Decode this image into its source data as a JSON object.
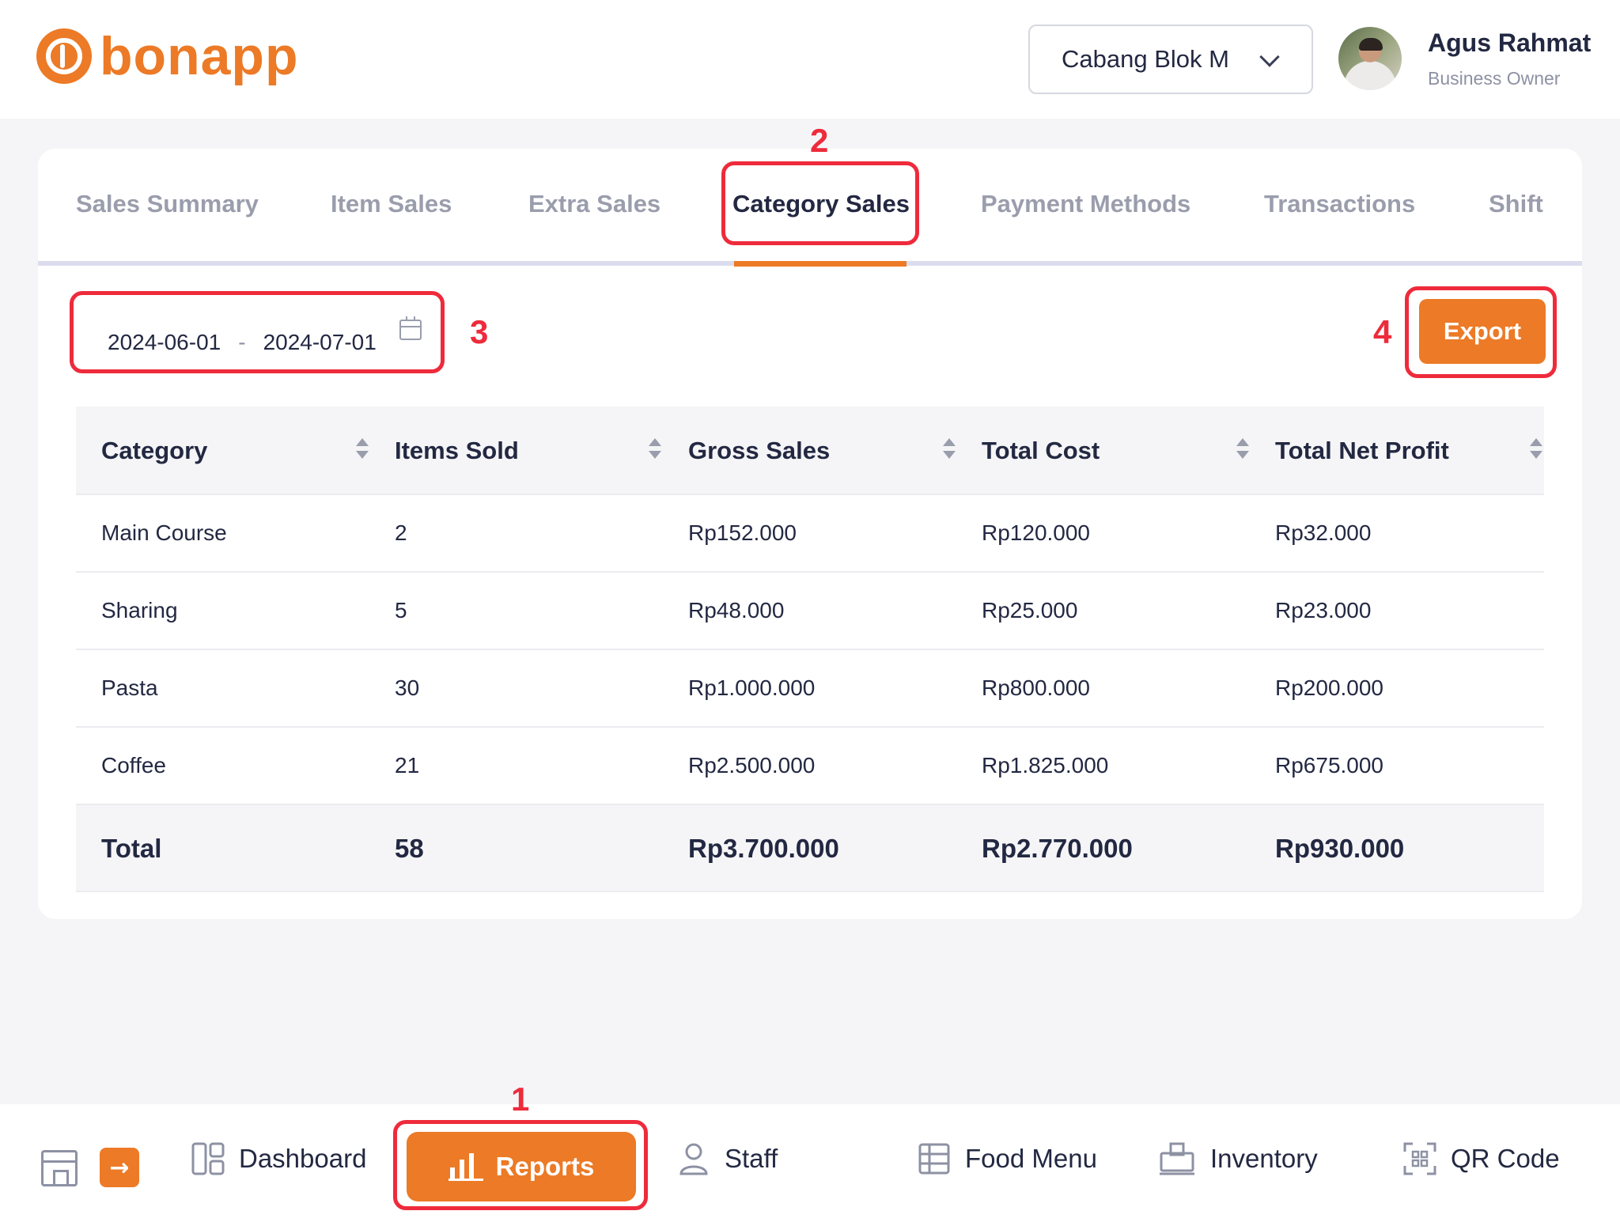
{
  "header": {
    "logo_text": "bonapp",
    "branch": "Cabang Blok M",
    "user_name": "Agus Rahmat",
    "user_role": "Business Owner"
  },
  "tabs": [
    {
      "label": "Sales Summary"
    },
    {
      "label": "Item Sales"
    },
    {
      "label": "Extra Sales"
    },
    {
      "label": "Category Sales"
    },
    {
      "label": "Payment Methods"
    },
    {
      "label": "Transactions"
    },
    {
      "label": "Shift"
    }
  ],
  "filters": {
    "start_date": "2024-06-01",
    "separator": "-",
    "end_date": "2024-07-01",
    "export_label": "Export"
  },
  "table": {
    "headers": [
      "Category",
      "Items Sold",
      "Gross Sales",
      "Total Cost",
      "Total Net Profit"
    ],
    "rows": [
      [
        "Main Course",
        "2",
        "Rp152.000",
        "Rp120.000",
        "Rp32.000"
      ],
      [
        "Sharing",
        "5",
        "Rp48.000",
        "Rp25.000",
        "Rp23.000"
      ],
      [
        "Pasta",
        "30",
        "Rp1.000.000",
        "Rp800.000",
        "Rp200.000"
      ],
      [
        "Coffee",
        "21",
        "Rp2.500.000",
        "Rp1.825.000",
        "Rp675.000"
      ]
    ],
    "total": [
      "Total",
      "58",
      "Rp3.700.000",
      "Rp2.770.000",
      "Rp930.000"
    ]
  },
  "bottom_nav": {
    "expand_glyph": "→",
    "items": [
      {
        "label": "Dashboard"
      },
      {
        "label": "Reports"
      },
      {
        "label": "Staff"
      },
      {
        "label": "Food Menu"
      },
      {
        "label": "Inventory"
      },
      {
        "label": "QR Code"
      }
    ]
  },
  "annotations": [
    "1",
    "2",
    "3",
    "4"
  ],
  "colors": {
    "accent": "#ec7a26",
    "annotation": "#ee2b3b",
    "text": "#232842",
    "muted": "#9a9dac"
  }
}
